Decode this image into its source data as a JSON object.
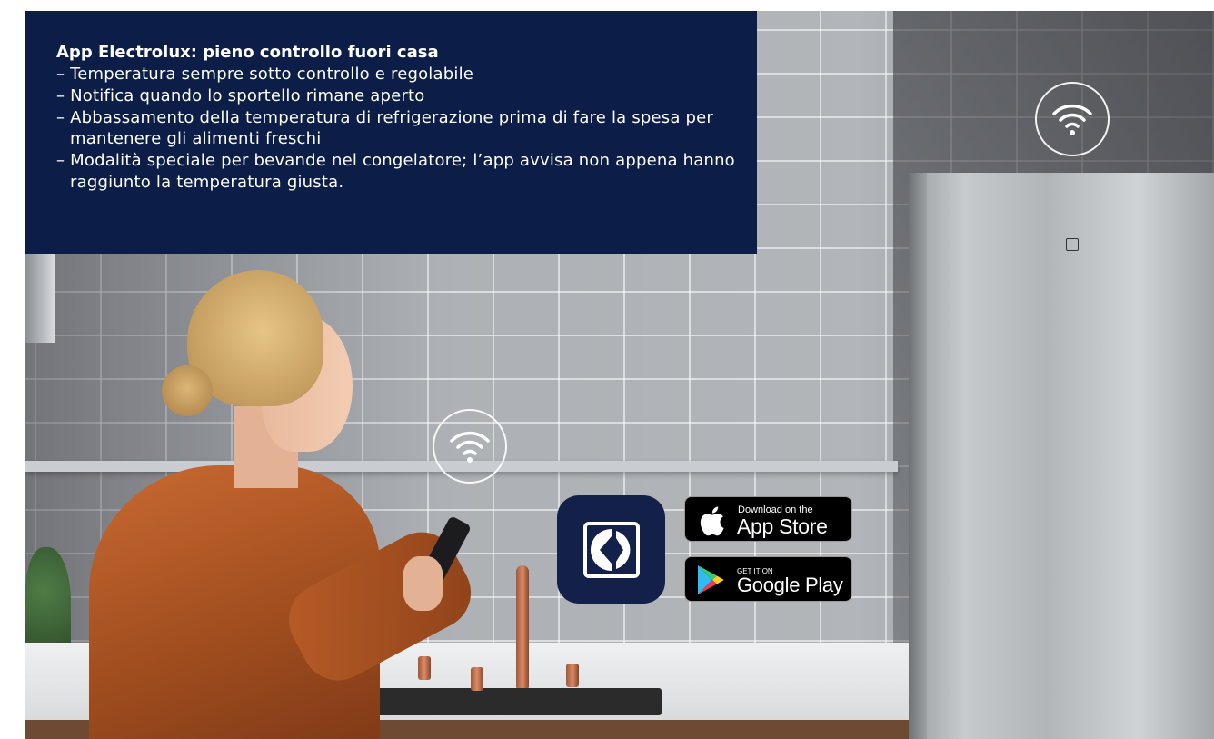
{
  "info_box": {
    "title": "App Electrolux: pieno controllo fuori casa",
    "items": [
      "– Temperatura sempre sotto controllo e regolabile",
      "– Notifica quando lo sportello rimane aperto",
      "– Abbassamento della temperatura di refrigerazione prima di fare la spesa per mantenere gli alimenti freschi",
      "– Modalità speciale per bevande nel congelatore; l’app avvisa non appena hanno raggiunto la temperatura giusta."
    ]
  },
  "badges": {
    "app_store": {
      "small": "Download on the",
      "big": "App Store",
      "icon": "apple-icon"
    },
    "google_play": {
      "small": "GET IT ON",
      "big": "Google Play",
      "icon": "google-play-icon"
    }
  },
  "icons": {
    "wifi": "wifi-icon",
    "app": "electrolux-app-icon"
  },
  "colors": {
    "info_bg": "#0c1d47",
    "app_icon_bg": "#13204a"
  }
}
